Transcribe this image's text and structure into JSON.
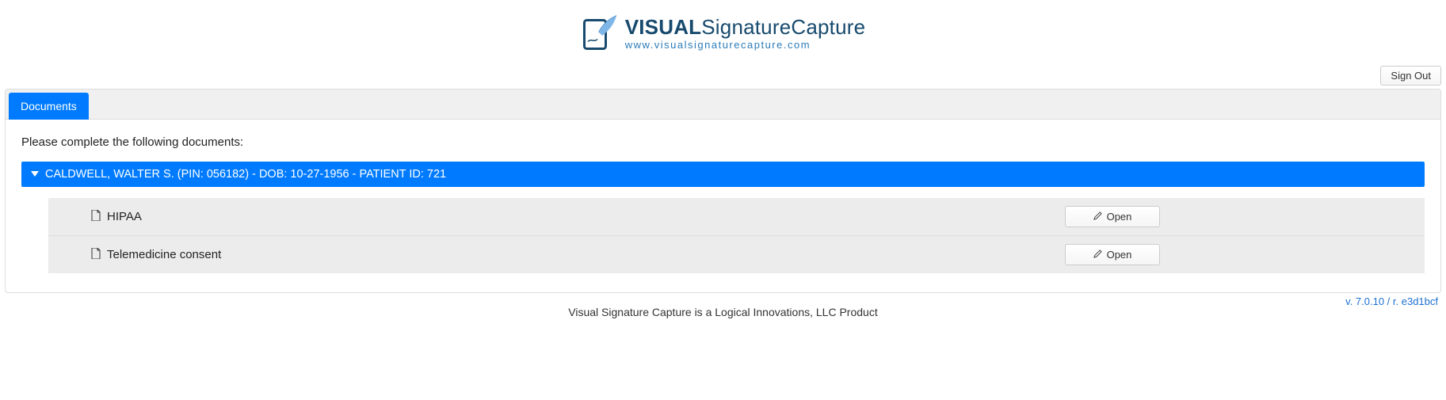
{
  "logo": {
    "brand_bold": "VISUAL",
    "brand_light": "Signature",
    "brand_mid": "Capture",
    "url": "www.visualsignaturecapture.com"
  },
  "topbar": {
    "signout_label": "Sign Out"
  },
  "tabs": {
    "documents_label": "Documents"
  },
  "main": {
    "instruction": "Please complete the following documents:",
    "patient_header": "CALDWELL, WALTER S. (PIN: 056182) - DOB: 10-27-1956 - PATIENT ID: 721",
    "documents": [
      {
        "name": "HIPAA",
        "open_label": "Open"
      },
      {
        "name": "Telemedicine consent",
        "open_label": "Open"
      }
    ]
  },
  "footer": {
    "text": "Visual Signature Capture is a Logical Innovations, LLC Product",
    "version": "v. 7.0.10 / r. e3d1bcf"
  }
}
